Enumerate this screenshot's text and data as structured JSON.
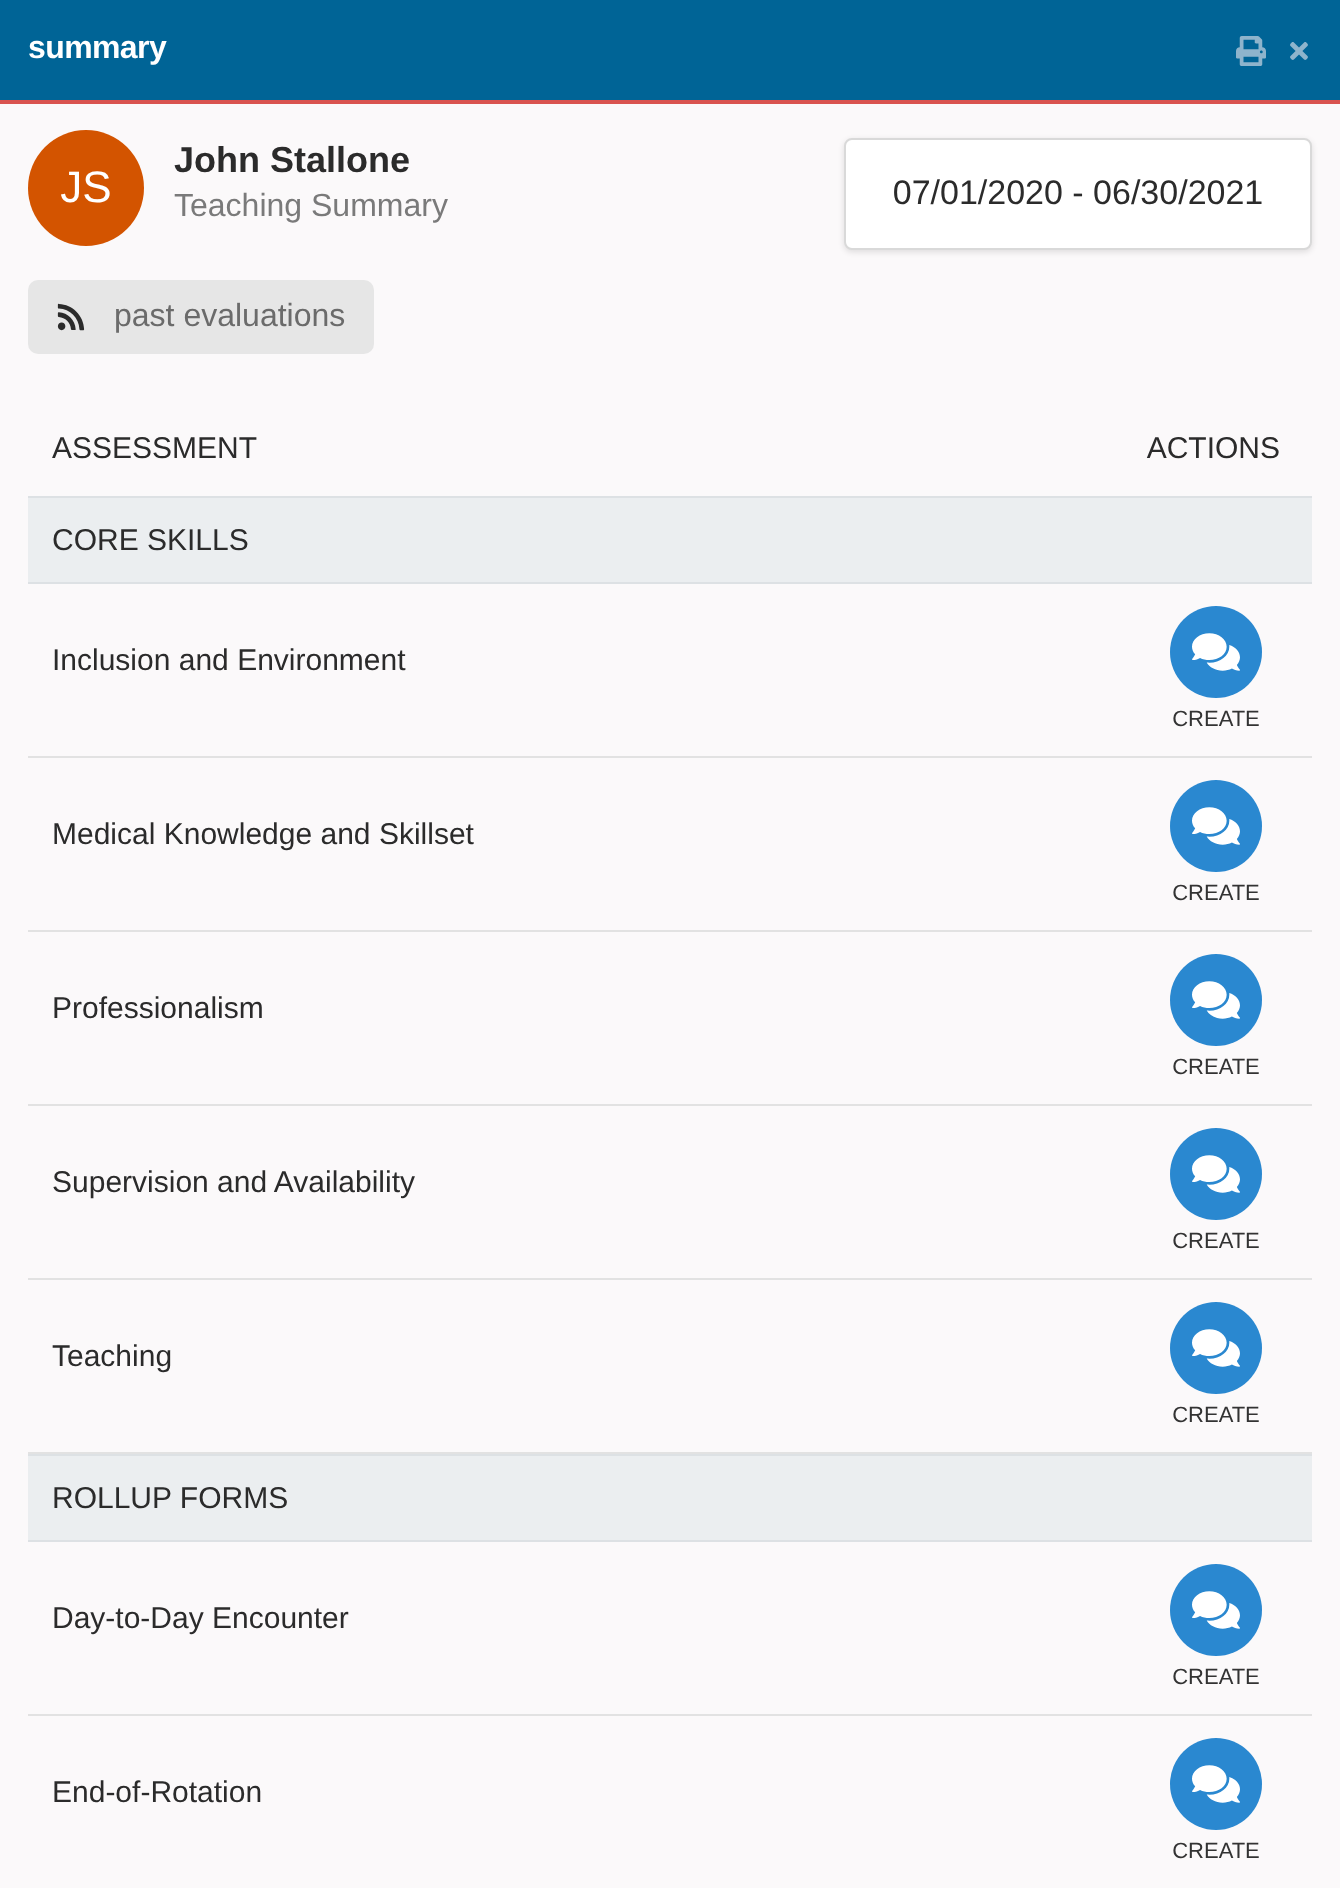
{
  "window": {
    "title": "summary"
  },
  "profile": {
    "initials": "JS",
    "name": "John Stallone",
    "subtitle": "Teaching Summary"
  },
  "date_range": "07/01/2020 - 06/30/2021",
  "past_evaluations_button": {
    "label": "past evaluations"
  },
  "table": {
    "columns": [
      "ASSESSMENT",
      "ACTIONS"
    ],
    "groups": [
      {
        "title": "CORE SKILLS",
        "rows": [
          {
            "name": "Inclusion and Environment",
            "action": "CREATE"
          },
          {
            "name": "Medical Knowledge and Skillset",
            "action": "CREATE"
          },
          {
            "name": "Professionalism",
            "action": "CREATE"
          },
          {
            "name": "Supervision and Availability",
            "action": "CREATE"
          },
          {
            "name": "Teaching",
            "action": "CREATE"
          }
        ]
      },
      {
        "title": "ROLLUP FORMS",
        "rows": [
          {
            "name": "Day-to-Day Encounter",
            "action": "CREATE"
          },
          {
            "name": "End-of-Rotation",
            "action": "CREATE"
          }
        ]
      }
    ]
  }
}
